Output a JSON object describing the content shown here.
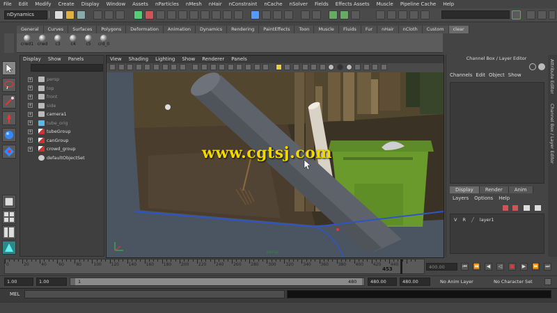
{
  "menubar": [
    "File",
    "Edit",
    "Modify",
    "Create",
    "Display",
    "Window",
    "Assets",
    "nParticles",
    "nMesh",
    "nHair",
    "nConstraint",
    "nCache",
    "nSolver",
    "Fields",
    "Effects Assets",
    "Muscle",
    "Pipeline Cache",
    "Help"
  ],
  "statusline": {
    "mode": "nDynamics"
  },
  "shelf": {
    "tabs": [
      "General",
      "Curves",
      "Surfaces",
      "Polygons",
      "Deformation",
      "Animation",
      "Dynamics",
      "Rendering",
      "PaintEffects",
      "Toon",
      "Muscle",
      "Fluids",
      "Fur",
      "nHair",
      "nCloth",
      "Custom",
      "clear"
    ],
    "active_tab": "clear",
    "buttons": [
      "crwd1",
      "crwd",
      "c3",
      "c4",
      "c5",
      "crd_0"
    ]
  },
  "outliner": {
    "menu": [
      "Display",
      "Show",
      "Panels"
    ],
    "items": [
      {
        "label": "persp",
        "dim": true,
        "icon": "camera-icon"
      },
      {
        "label": "top",
        "dim": true,
        "icon": "camera-icon"
      },
      {
        "label": "front",
        "dim": true,
        "icon": "camera-icon"
      },
      {
        "label": "side",
        "dim": true,
        "icon": "camera-icon"
      },
      {
        "label": "camera1",
        "dim": false,
        "icon": "camera-icon"
      },
      {
        "label": "tube_orig",
        "dim": true,
        "icon": "mesh-icon"
      },
      {
        "label": "tubeGroup",
        "dim": false,
        "icon": "group-icon"
      },
      {
        "label": "canGroup",
        "dim": false,
        "icon": "group-icon"
      },
      {
        "label": "crowd_group",
        "dim": false,
        "icon": "group-icon"
      },
      {
        "label": "defaultObjectSet",
        "dim": false,
        "icon": "set-icon"
      }
    ]
  },
  "viewport": {
    "menu": [
      "View",
      "Shading",
      "Lighting",
      "Show",
      "Renderer",
      "Panels"
    ],
    "camera_label": "persp"
  },
  "watermark": "www.cgtsj.com",
  "channelbox": {
    "title": "Channel Box / Layer Editor",
    "menu": [
      "Channels",
      "Edit",
      "Object",
      "Show"
    ],
    "layer_tabs": [
      "Display",
      "Render",
      "Anim"
    ],
    "layer_menu": [
      "Layers",
      "Options",
      "Help"
    ],
    "layer": {
      "v": "V",
      "r": "R",
      "name": "layer1"
    },
    "side_tabs": [
      "Attribute Editor",
      "Channel Box / Layer Editor"
    ]
  },
  "timeline": {
    "ticks": [
      "0",
      "20",
      "40",
      "60",
      "80",
      "100",
      "120",
      "140",
      "160",
      "180",
      "200",
      "220",
      "240",
      "260",
      "280",
      "300",
      "320",
      "340",
      "360",
      "380",
      "400",
      "420",
      "440"
    ],
    "current_frame": "453",
    "frame_field": "400.00"
  },
  "playback": [
    "⏮",
    "⏪",
    "◀",
    "◁",
    "■",
    "▶",
    "⏩",
    "⏭"
  ],
  "range": {
    "start_min": "1.00",
    "start": "1.00",
    "slider_start": "1",
    "slider_end": "480",
    "end": "480.00",
    "end_max": "480.00",
    "anim_layer": "No Anim Layer",
    "character_set": "No Character Set"
  },
  "cmdline": {
    "label": "MEL"
  }
}
